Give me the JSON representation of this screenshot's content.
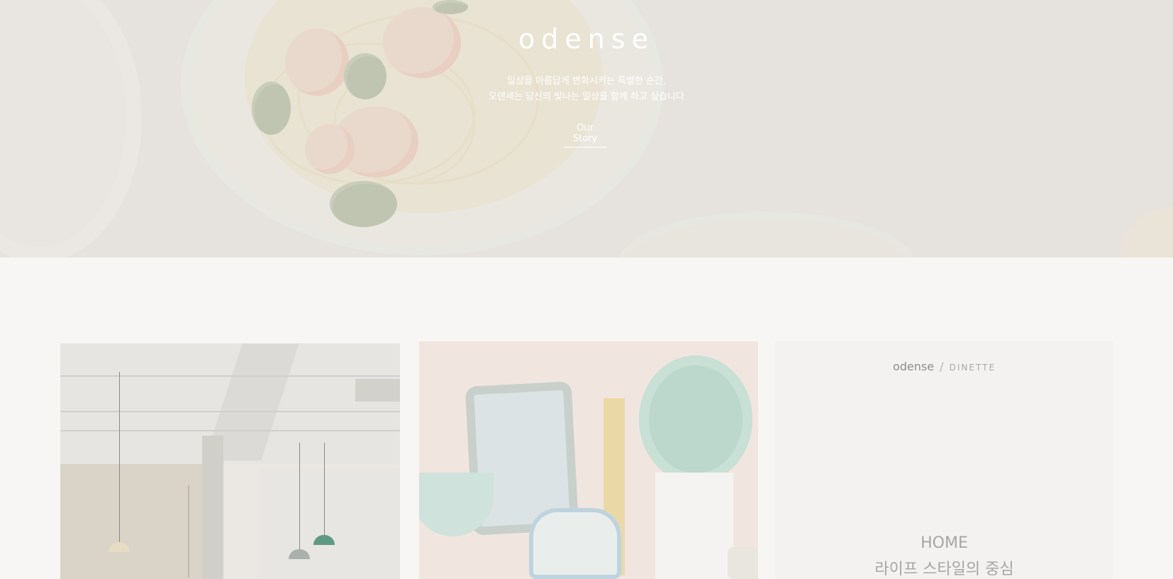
{
  "hero": {
    "brand": "odense",
    "tagline_1": "일상을 아름답게 변화시키는 특별한 순간,",
    "tagline_2": "오덴세는 당신의 빛나는 일상을 함께 하고 싶습니다",
    "link_label": "Our Story"
  },
  "feature_card": {
    "brand": "odense",
    "divider": "/",
    "category": "DINETTE",
    "title": "HOME",
    "subtitle": "라이프 스타일의 중심"
  }
}
